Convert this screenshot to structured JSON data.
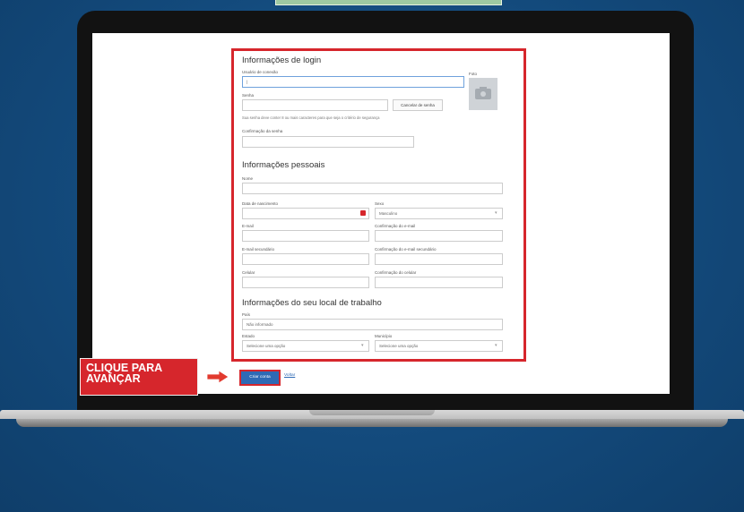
{
  "callout": {
    "line1": "CLIQUE PARA",
    "line2": "AVANÇAR"
  },
  "login": {
    "title": "Informações de login",
    "username_label": "Usuário de conexão",
    "username_value": "|",
    "photo_label": "Foto",
    "password_label": "Senha",
    "password_button": "Cancelar de senha",
    "password_help": "Sua senha deve conter 8 ou mais caracteres para que seja o critério de segurança",
    "confirm_label": "Confirmação da senha"
  },
  "personal": {
    "title": "Informações pessoais",
    "name_label": "Nome",
    "birth_label": "Data de nascimento",
    "sex_label": "Sexo",
    "sex_value": "Masculino",
    "email_label": "E-mail",
    "email_confirm_label": "Confirmação do e-mail",
    "email2_label": "E-mail secundário",
    "email2_confirm_label": "Confirmação do e-mail secundário",
    "cell_label": "Celular",
    "cell_confirm_label": "Confirmação do celular"
  },
  "work": {
    "title": "Informações do seu local de trabalho",
    "country_label": "País",
    "country_value": "Não informado",
    "state_label": "Estado",
    "state_value": "Selecione uma opção",
    "city_label": "Município",
    "city_value": "Selecione uma opção"
  },
  "actions": {
    "create": "Criar conta",
    "back": "Voltar"
  },
  "colors": {
    "background": "#134a7c",
    "highlight": "#d6262c",
    "primary_button": "#2e6ab5"
  }
}
